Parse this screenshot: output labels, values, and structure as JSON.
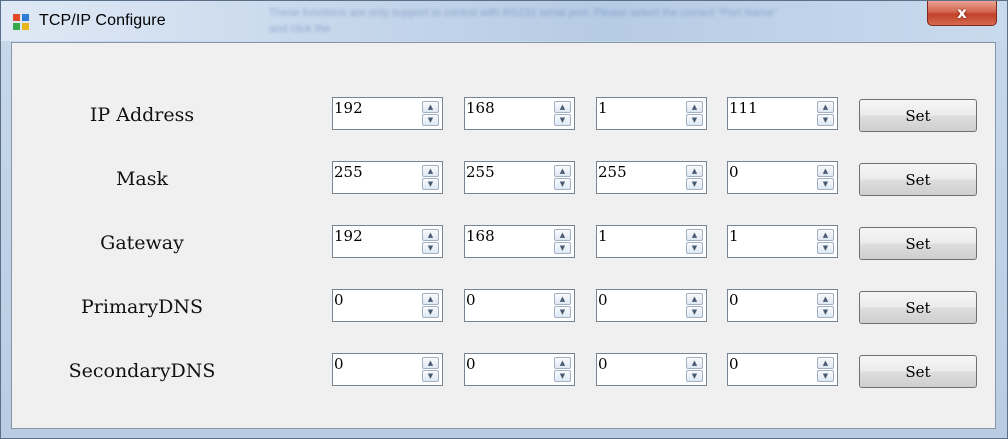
{
  "window": {
    "title": "TCP/IP Configure",
    "close_glyph": "x",
    "background_text": "These functions are only support to control with RS232 serial port. Please select the correct \"Port Name\" and click the"
  },
  "rows": [
    {
      "label": "IP Address",
      "octets": [
        "192",
        "168",
        "1",
        "111"
      ],
      "button": "Set"
    },
    {
      "label": "Mask",
      "octets": [
        "255",
        "255",
        "255",
        "0"
      ],
      "button": "Set"
    },
    {
      "label": "Gateway",
      "octets": [
        "192",
        "168",
        "1",
        "1"
      ],
      "button": "Set"
    },
    {
      "label": "PrimaryDNS",
      "octets": [
        "0",
        "0",
        "0",
        "0"
      ],
      "button": "Set"
    },
    {
      "label": "SecondaryDNS",
      "octets": [
        "0",
        "0",
        "0",
        "0"
      ],
      "button": "Set"
    }
  ],
  "icons": {
    "app": "app-window-icon",
    "spin_up": "spin-up-arrow-icon",
    "spin_down": "spin-down-arrow-icon",
    "close": "close-icon"
  },
  "colors": {
    "close_button": "#c9513a",
    "titlebar": "#c9d9ec",
    "client": "#f0f0f0"
  }
}
